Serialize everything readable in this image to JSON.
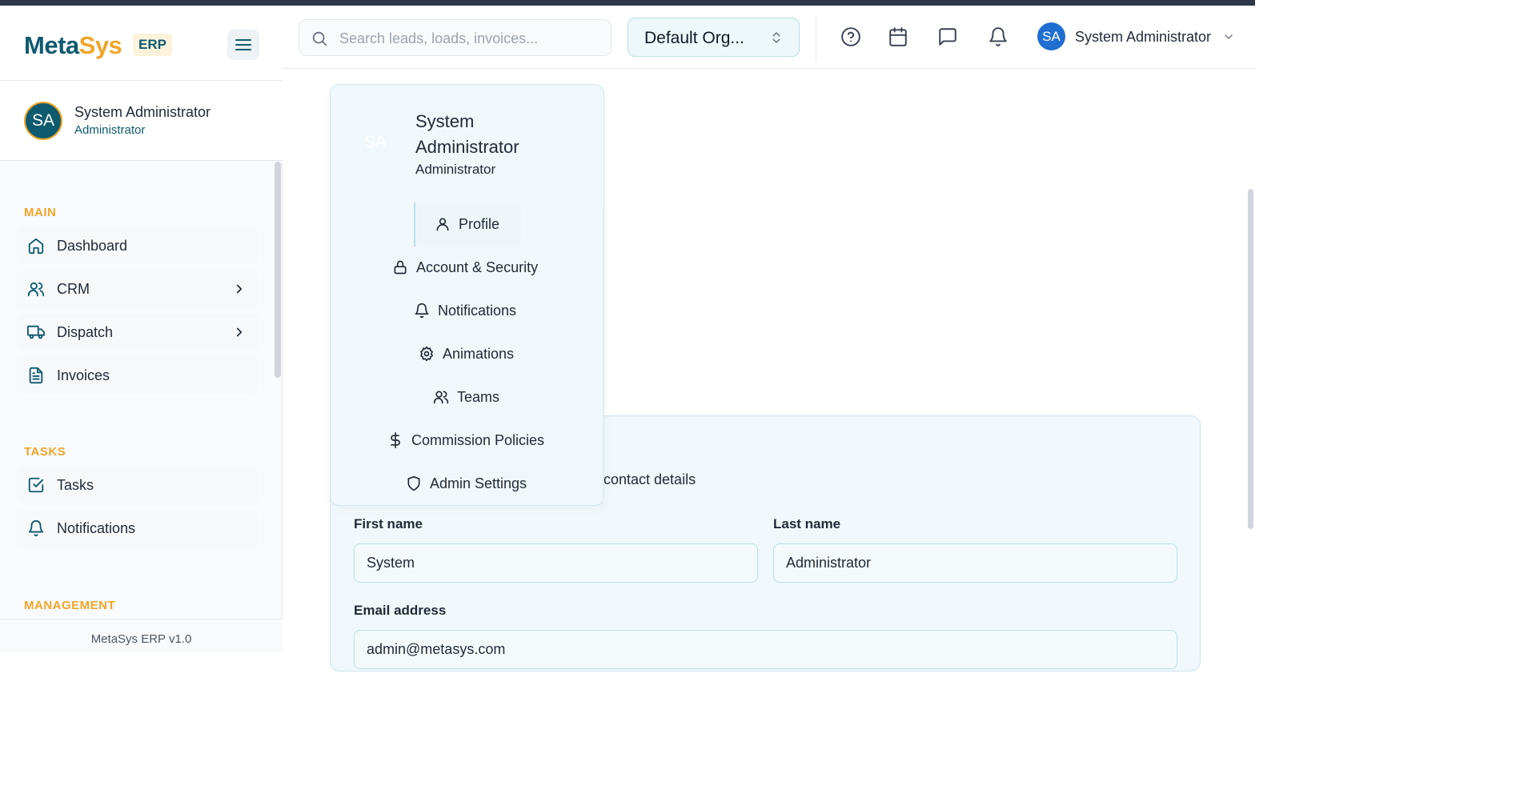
{
  "brand": {
    "name_part1": "Meta",
    "name_part2": "Sys",
    "badge": "ERP"
  },
  "user_card": {
    "initials": "SA",
    "name": "System Administrator",
    "role": "Administrator"
  },
  "nav": {
    "sections": [
      {
        "title": "MAIN"
      },
      {
        "title": "TASKS"
      },
      {
        "title": "MANAGEMENT"
      }
    ],
    "items": [
      {
        "label": "Dashboard",
        "icon": "home-icon"
      },
      {
        "label": "CRM",
        "icon": "users-icon",
        "has_children": true
      },
      {
        "label": "Dispatch",
        "icon": "truck-icon",
        "has_children": true
      },
      {
        "label": "Invoices",
        "icon": "file-text-icon"
      },
      {
        "label": "Tasks",
        "icon": "check-square-icon"
      },
      {
        "label": "Notifications",
        "icon": "bell-icon"
      }
    ]
  },
  "footer": {
    "version": "MetaSys ERP v1.0"
  },
  "header": {
    "search_placeholder": "Search leads, loads, invoices...",
    "org_label": "Default Org...",
    "user_initials": "SA",
    "user_name": "System Administrator",
    "icons": [
      "help-circle-icon",
      "calendar-icon",
      "message-square-icon",
      "bell-icon"
    ]
  },
  "dropdown": {
    "avatar_initials": "SA",
    "name": "System Administrator",
    "role": "Administrator",
    "items": [
      {
        "label": "Profile",
        "icon": "user-icon",
        "active": true
      },
      {
        "label": "Account & Security",
        "icon": "lock-icon"
      },
      {
        "label": "Notifications",
        "icon": "bell-icon"
      },
      {
        "label": "Animations",
        "icon": "gear-icon"
      },
      {
        "label": "Teams",
        "icon": "users-icon"
      },
      {
        "label": "Commission Policies",
        "icon": "dollar-icon"
      },
      {
        "label": "Admin Settings",
        "icon": "shield-icon"
      }
    ]
  },
  "profile_form": {
    "description_visible": "contact details",
    "first_name_label": "First name",
    "first_name_value": "System",
    "last_name_label": "Last name",
    "last_name_value": "Administrator",
    "email_label": "Email address",
    "email_value": "admin@metasys.com"
  },
  "colors": {
    "brand_teal": "#0e5a6e",
    "brand_orange": "#f0a52a",
    "avatar_blue": "#1f6fd1",
    "panel_bg": "#f1f8fb"
  }
}
